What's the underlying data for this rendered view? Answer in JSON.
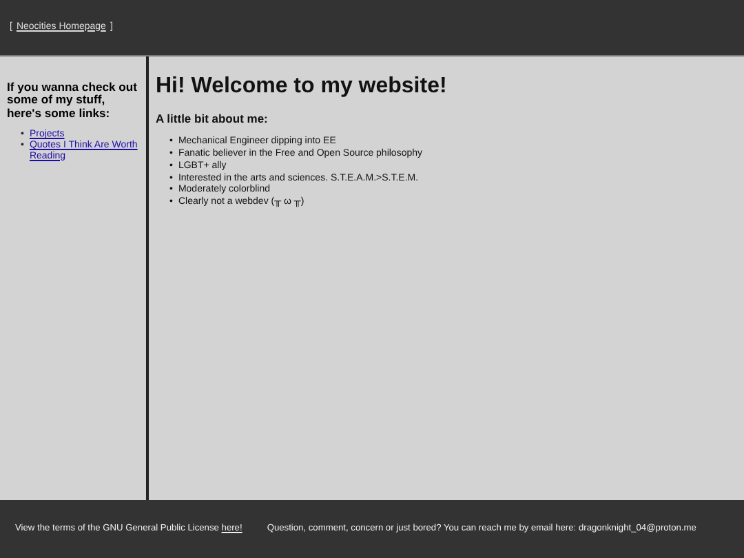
{
  "header": {
    "prefix": "[",
    "link": "Neocities Homepage",
    "suffix": "]"
  },
  "list_marker": "•",
  "sidebar": {
    "heading": "If you wanna check out some of my stuff, here's some links:",
    "links": [
      "Projects",
      "Quotes I Think Are Worth Reading"
    ]
  },
  "main": {
    "title": "Hi! Welcome to my website!",
    "subtitle": "A little bit about me:",
    "facts": [
      "Mechanical Engineer dipping into EE",
      "Fanatic believer in the Free and Open Source philosophy",
      "LGBT+ ally",
      "Interested in the arts and sciences. S.T.E.A.M.>S.T.E.M.",
      "Moderately colorblind",
      "Clearly not a webdev (╥ ω ╥)"
    ]
  },
  "footer": {
    "license_text": "View the terms of the GNU General Public License",
    "license_link": "here!",
    "contact": "Question, comment, concern or just bored? You can reach me by email here: dragonknight_04@proton.me"
  }
}
